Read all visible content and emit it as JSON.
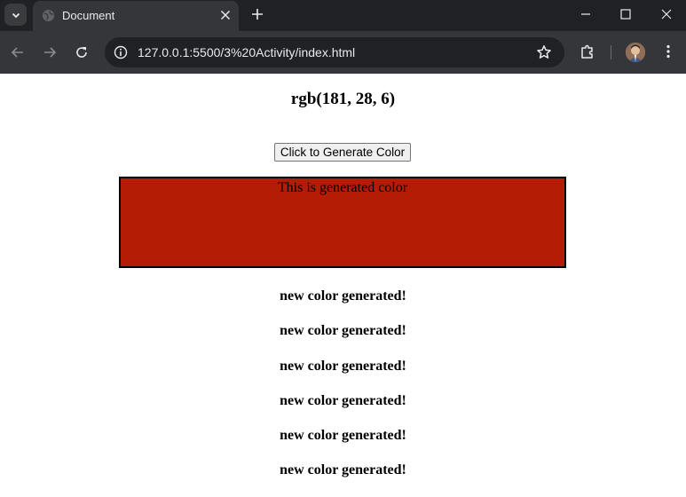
{
  "browser": {
    "tab_title": "Document",
    "url": "127.0.0.1:5500/3%20Activity/index.html",
    "icons": {
      "tab_menu": "chevron-down-icon",
      "favicon": "globe-icon",
      "close_tab": "close-icon",
      "new_tab": "plus-icon",
      "back": "arrow-left-icon",
      "forward": "arrow-right-icon",
      "reload": "reload-icon",
      "site_info": "site-info-icon",
      "bookmark": "star-icon",
      "extensions": "puzzle-icon",
      "profile": "avatar",
      "menu": "kebab-menu-icon",
      "minimize": "minimize-icon",
      "maximize": "maximize-icon",
      "close_window": "close-window-icon"
    },
    "colors": {
      "tabbar": "#202124",
      "toolbar": "#35363a",
      "omnibox": "#202124"
    }
  },
  "page": {
    "heading": "rgb(181, 28, 6)",
    "button_label": "Click to Generate Color",
    "box_text": "This is generated color",
    "box_color": "#b51c06",
    "log_items": [
      "new color generated!",
      "new color generated!",
      "new color generated!",
      "new color generated!",
      "new color generated!",
      "new color generated!"
    ]
  }
}
